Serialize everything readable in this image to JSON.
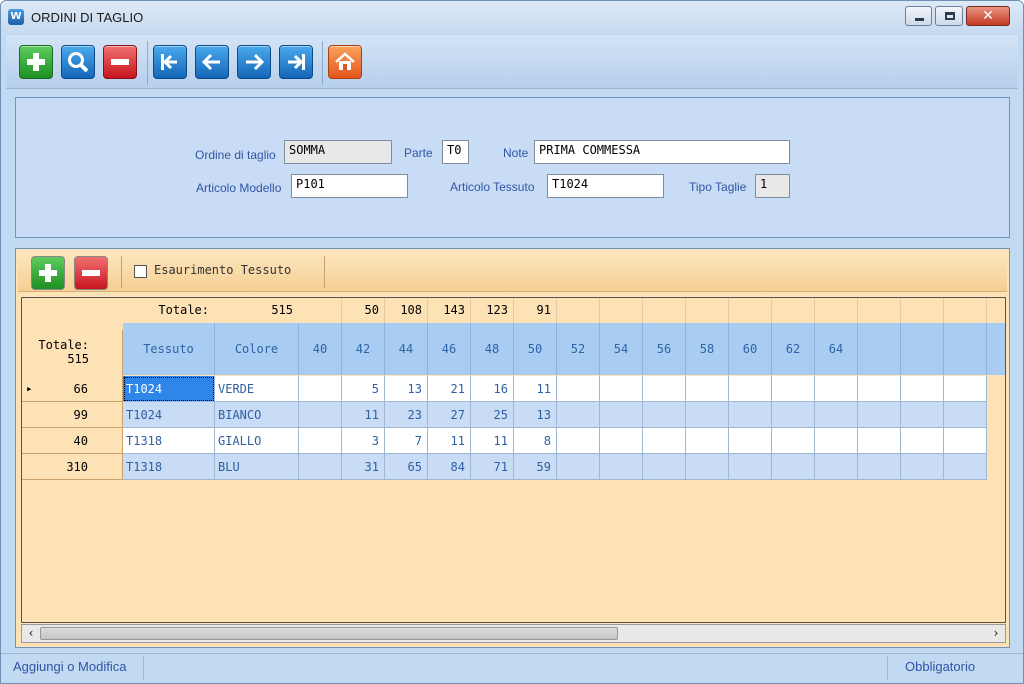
{
  "window": {
    "title": "ORDINI DI TAGLIO"
  },
  "toolbar": {
    "buttons": [
      {
        "name": "add-icon",
        "color": "green"
      },
      {
        "name": "search-icon",
        "color": "blue"
      },
      {
        "name": "remove-icon",
        "color": "red"
      },
      {
        "name": "first-record-icon",
        "color": "blue"
      },
      {
        "name": "previous-record-icon",
        "color": "blue"
      },
      {
        "name": "next-record-icon",
        "color": "blue"
      },
      {
        "name": "last-record-icon",
        "color": "blue"
      },
      {
        "name": "home-icon",
        "color": "orange"
      }
    ]
  },
  "form": {
    "ordine_label": "Ordine di taglio",
    "ordine_value": "SOMMA",
    "parte_label": "Parte",
    "parte_value": "T0",
    "note_label": "Note",
    "note_value": "PRIMA COMMESSA",
    "modello_label": "Articolo Modello",
    "modello_value": "P101",
    "tessuto_label": "Articolo Tessuto",
    "tessuto_value": "T1024",
    "tipo_label": "Tipo Taglie",
    "tipo_value": "1"
  },
  "grid_toolbar": {
    "checkbox_label": "Esaurimento Tessuto",
    "checked": false
  },
  "grid": {
    "corner_label": "Totale:",
    "corner_value": "515",
    "totals_label": "Totale:",
    "totals_value": "515",
    "column_headers": [
      "Tessuto",
      "Colore",
      "40",
      "42",
      "44",
      "46",
      "48",
      "50",
      "52",
      "54",
      "56",
      "58",
      "60",
      "62",
      "64",
      "",
      "",
      ""
    ],
    "size_totals": [
      "",
      "50",
      "108",
      "143",
      "123",
      "91",
      "",
      "",
      "",
      "",
      "",
      "",
      "",
      "",
      "",
      ""
    ],
    "rows": [
      {
        "total": "66",
        "tessuto": "T1024",
        "colore": "VERDE",
        "values": [
          "",
          "5",
          "13",
          "21",
          "16",
          "11",
          "",
          "",
          "",
          "",
          "",
          "",
          "",
          "",
          "",
          ""
        ]
      },
      {
        "total": "99",
        "tessuto": "T1024",
        "colore": "BIANCO",
        "values": [
          "",
          "11",
          "23",
          "27",
          "25",
          "13",
          "",
          "",
          "",
          "",
          "",
          "",
          "",
          "",
          "",
          ""
        ]
      },
      {
        "total": "40",
        "tessuto": "T1318",
        "colore": "GIALLO",
        "values": [
          "",
          "3",
          "7",
          "11",
          "11",
          "8",
          "",
          "",
          "",
          "",
          "",
          "",
          "",
          "",
          "",
          ""
        ]
      },
      {
        "total": "310",
        "tessuto": "T1318",
        "colore": "BLU",
        "values": [
          "",
          "31",
          "65",
          "84",
          "71",
          "59",
          "",
          "",
          "",
          "",
          "",
          "",
          "",
          "",
          "",
          ""
        ]
      }
    ]
  },
  "status": {
    "left": "Aggiungi o Modifica",
    "right": "Obbligatorio"
  }
}
